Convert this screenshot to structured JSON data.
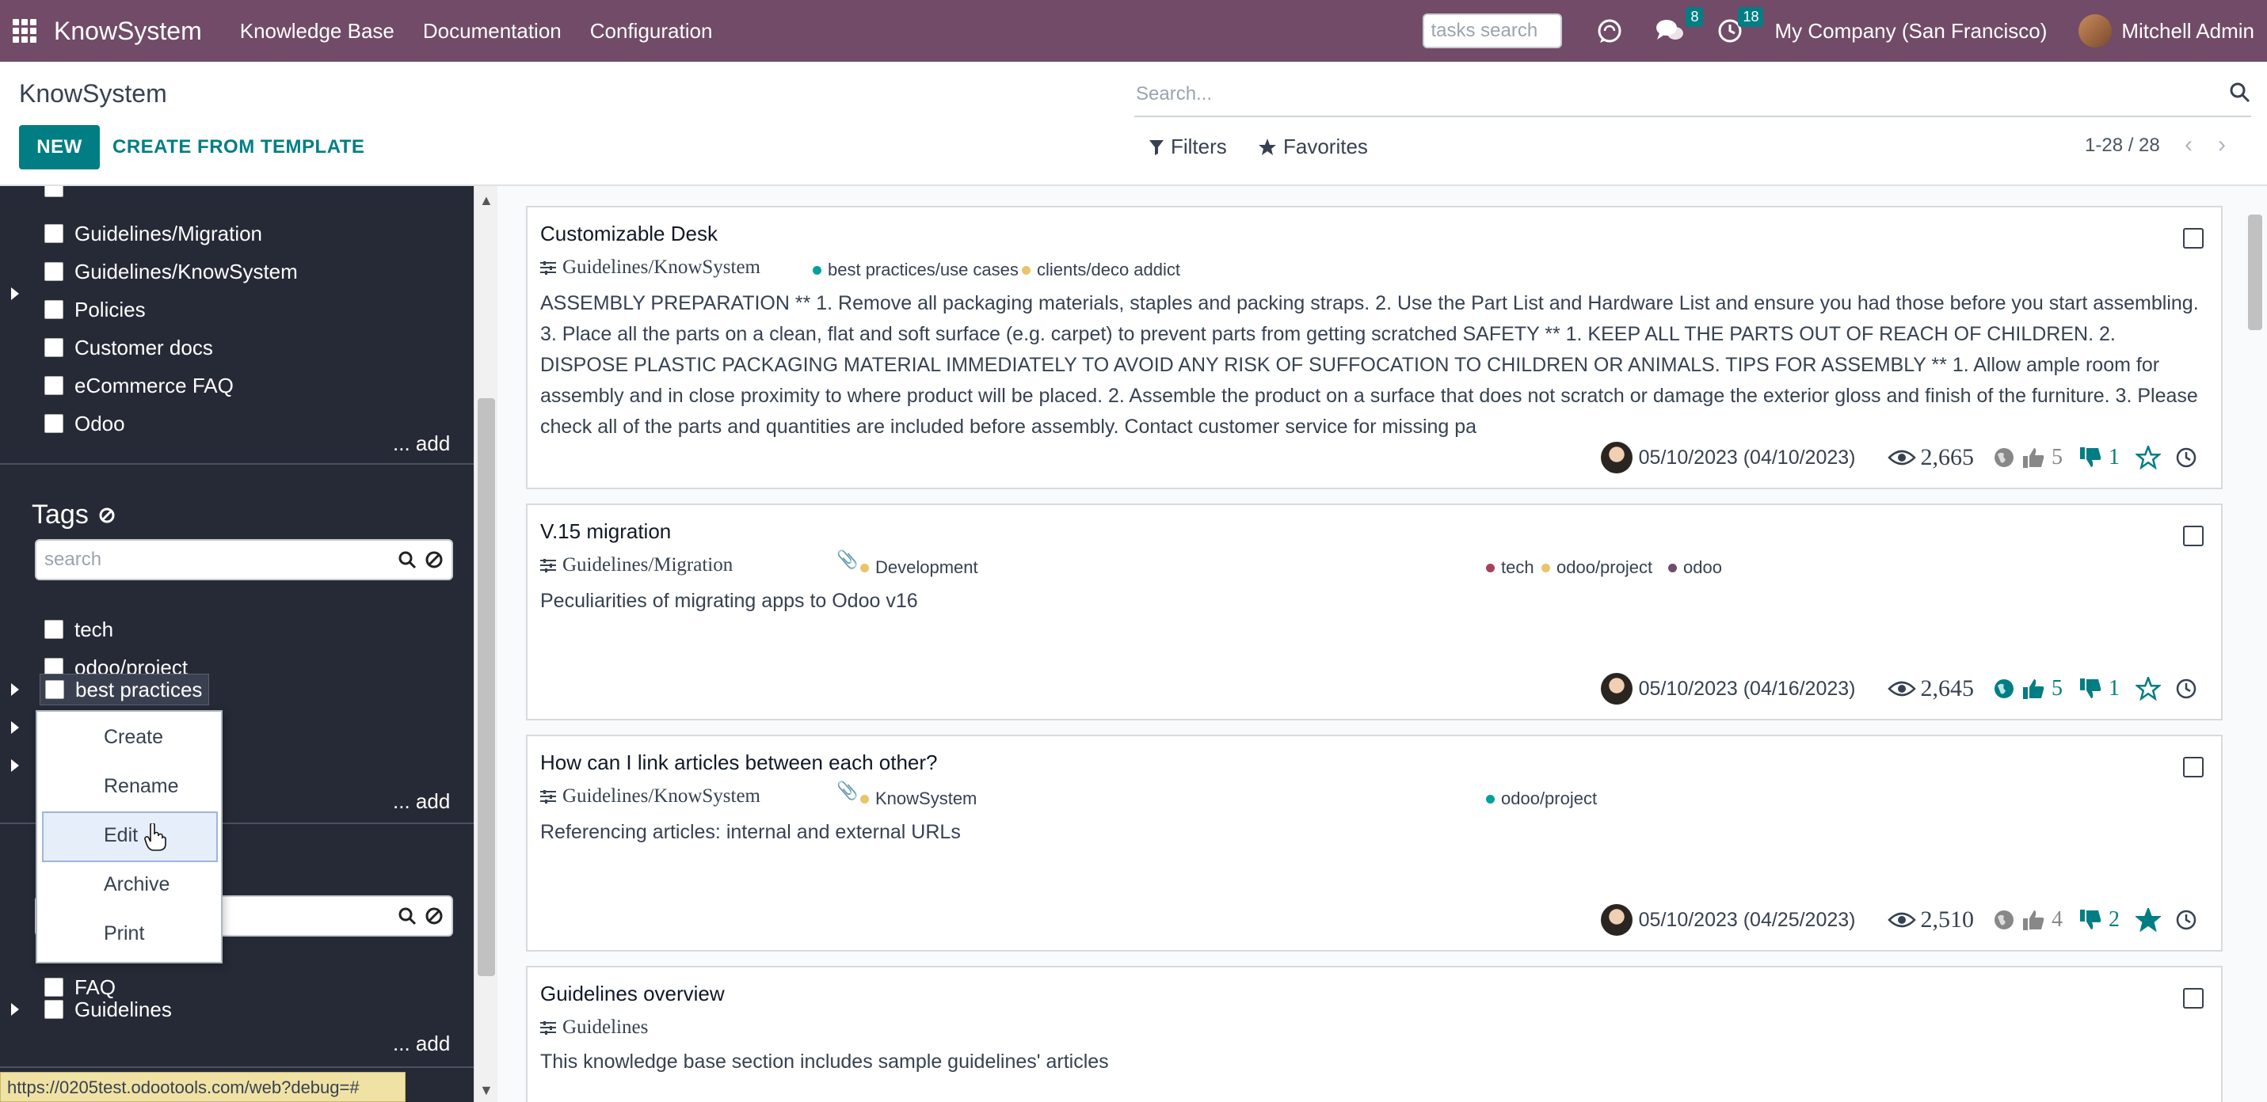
{
  "topbar": {
    "brand": "KnowSystem",
    "menus": [
      "Knowledge Base",
      "Documentation",
      "Configuration"
    ],
    "tasks_search_placeholder": "tasks search",
    "messages_count": "8",
    "activities_count": "18",
    "company": "My Company (San Francisco)",
    "user": "Mitchell Admin"
  },
  "control": {
    "title": "KnowSystem",
    "new_label": "NEW",
    "template_label": "CREATE FROM TEMPLATE",
    "search_placeholder": "Search...",
    "filters_label": "Filters",
    "favorites_label": "Favorites",
    "pager": "1-28 / 28"
  },
  "sidebar": {
    "sections_items": [
      "Guidelines/Migration",
      "Guidelines/KnowSystem",
      "Policies",
      "Customer docs",
      "eCommerce FAQ",
      "Odoo"
    ],
    "add_label": "... add",
    "tags_title": "Tags",
    "tags_search_placeholder": "search",
    "tags": [
      "tech",
      "odoo/project",
      "best practices"
    ],
    "types": [
      "FAQ",
      "Guidelines"
    ]
  },
  "context_menu": {
    "items": [
      "Create",
      "Rename",
      "Edit",
      "Archive",
      "Print"
    ],
    "active": "Edit"
  },
  "status_url": "https://0205test.odootools.com/web?debug=#",
  "colors": {
    "navbar": "#714b67",
    "accent": "#017e84",
    "sidebar": "#262a36",
    "tag_green": "#00a09d",
    "tag_yellow": "#e9c46a",
    "tag_red": "#a7425b",
    "tag_purple": "#6d4e6b"
  },
  "cards": [
    {
      "title": "Customizable Desk",
      "section": "Guidelines/KnowSystem",
      "tags": [
        "best practices/use cases",
        "clients/deco addict"
      ],
      "body": "ASSEMBLY PREPARATION ** 1. Remove all packaging materials, staples and packing straps. 2. Use the Part List and Hardware List and ensure you had those before you start assembling. 3. Place all the parts on a clean, flat and soft surface (e.g. carpet) to prevent parts from getting scratched SAFETY ** 1. KEEP ALL THE PARTS OUT OF REACH OF CHILDREN. 2. DISPOSE PLASTIC PACKAGING MATERIAL IMMEDIATELY TO AVOID ANY RISK OF SUFFOCATION TO CHILDREN OR ANIMALS. TIPS FOR ASSEMBLY ** 1. Allow ample room for assembly and in close proximity to where product will be placed. 2. Assemble the product on a surface that does not scratch or damage the exterior gloss and finish of the furniture. 3. Please check all of the parts and quantities are included before assembly. Contact customer service for missing pa",
      "dates": "05/10/2023 (04/10/2023)",
      "views": "2,665",
      "likes": "5",
      "dislikes": "1"
    },
    {
      "title": "V.15 migration",
      "section": "Guidelines/Migration",
      "tags_left": [
        "Development"
      ],
      "tags_right": [
        "tech",
        "odoo/project",
        "odoo"
      ],
      "body": "Peculiarities of migrating apps to Odoo v16",
      "dates": "05/10/2023 (04/16/2023)",
      "views": "2,645",
      "likes": "5",
      "dislikes": "1"
    },
    {
      "title": "How can I link articles between each other?",
      "section": "Guidelines/KnowSystem",
      "tags_left": [
        "KnowSystem"
      ],
      "tags_right": [
        "odoo/project"
      ],
      "body": "Referencing articles: internal and external URLs",
      "dates": "05/10/2023 (04/25/2023)",
      "views": "2,510",
      "likes": "4",
      "dislikes": "2"
    },
    {
      "title": "Guidelines overview",
      "section": "Guidelines",
      "body": "This knowledge base section includes sample guidelines' articles"
    }
  ]
}
